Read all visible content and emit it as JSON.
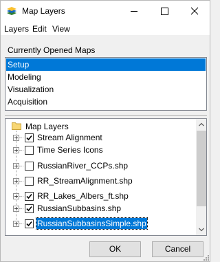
{
  "window": {
    "title": "Map Layers"
  },
  "menu": {
    "items": [
      "Layers",
      "Edit",
      "View"
    ]
  },
  "maps": {
    "header": "Currently Opened Maps",
    "items": [
      {
        "label": "Setup",
        "selected": true
      },
      {
        "label": "Modeling",
        "selected": false
      },
      {
        "label": "Visualization",
        "selected": false
      },
      {
        "label": "Acquisition",
        "selected": false
      }
    ]
  },
  "layers": {
    "root": "Map Layers",
    "items": [
      {
        "label": "Stream Alignment",
        "checked": true
      },
      {
        "label": "Time Series Icons",
        "checked": false
      },
      {
        "label": "RussianRiver_CCPs.shp",
        "checked": false
      },
      {
        "label": "RR_StreamAlignment.shp",
        "checked": false
      },
      {
        "label": "RR_Lakes_Albers_ft.shp",
        "checked": true
      },
      {
        "label": "RussianSubbasins.shp",
        "checked": true
      },
      {
        "label": "RussianSubbasinsSimple.shp",
        "checked": true,
        "selected": true
      }
    ]
  },
  "buttons": {
    "ok": "OK",
    "cancel": "Cancel"
  },
  "colors": {
    "selection": "#0078d7",
    "folder": "#f8d775"
  }
}
